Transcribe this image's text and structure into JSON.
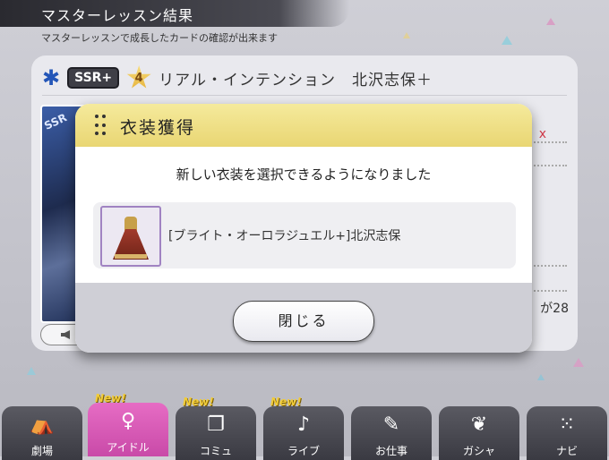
{
  "header": {
    "title": "マスターレッスン結果",
    "subtitle": "マスターレッスンで成長したカードの確認が出来ます"
  },
  "card": {
    "rarity": "SSR+",
    "star_level": "4",
    "name": "リアル・インテンション　北沢志保＋",
    "thumb_label": "SSR",
    "right_value_fragment": "x",
    "right_count_fragment": "が28"
  },
  "modal": {
    "title": "衣装獲得",
    "message": "新しい衣装を選択できるようになりました",
    "item_name": "[ブライト・オーロラジュエル+]北沢志保",
    "close_label": "閉じる"
  },
  "nav": {
    "new_badge": "New!",
    "items": [
      {
        "label": "劇場",
        "icon": "theater-icon",
        "new": false,
        "active": false
      },
      {
        "label": "アイドル",
        "icon": "idol-icon",
        "new": true,
        "active": true
      },
      {
        "label": "コミュ",
        "icon": "commu-icon",
        "new": true,
        "active": false
      },
      {
        "label": "ライブ",
        "icon": "live-icon",
        "new": true,
        "active": false
      },
      {
        "label": "お仕事",
        "icon": "work-icon",
        "new": false,
        "active": false
      },
      {
        "label": "ガシャ",
        "icon": "gacha-icon",
        "new": false,
        "active": false
      },
      {
        "label": "ナビ",
        "icon": "navi-icon",
        "new": false,
        "active": false
      }
    ]
  },
  "colors": {
    "modal_header": "#e9d673",
    "active_tab": "#d95ab6",
    "rarity_icon": "#2456b8"
  }
}
